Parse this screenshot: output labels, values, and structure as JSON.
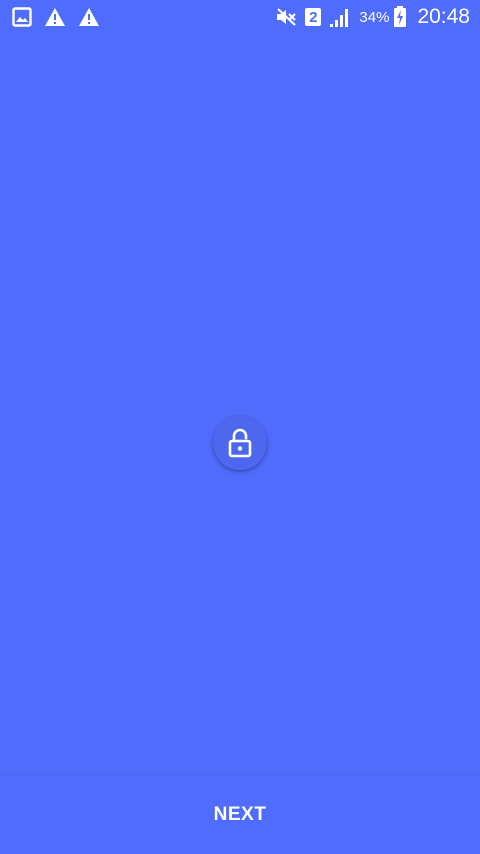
{
  "status_bar": {
    "left_icons": [
      "image-icon",
      "warning-icon",
      "warning-icon"
    ],
    "mute_icon": "mute-icon",
    "sim_label": "2",
    "signal_icon": "signal-icon",
    "battery_percent": "34%",
    "battery_icon": "battery-charging-icon",
    "time": "20:48"
  },
  "center": {
    "icon": "unlock-icon"
  },
  "footer": {
    "next_label": "NEXT"
  },
  "colors": {
    "background": "#506cfd",
    "button": "#4d67ee",
    "text": "#ffffff"
  }
}
